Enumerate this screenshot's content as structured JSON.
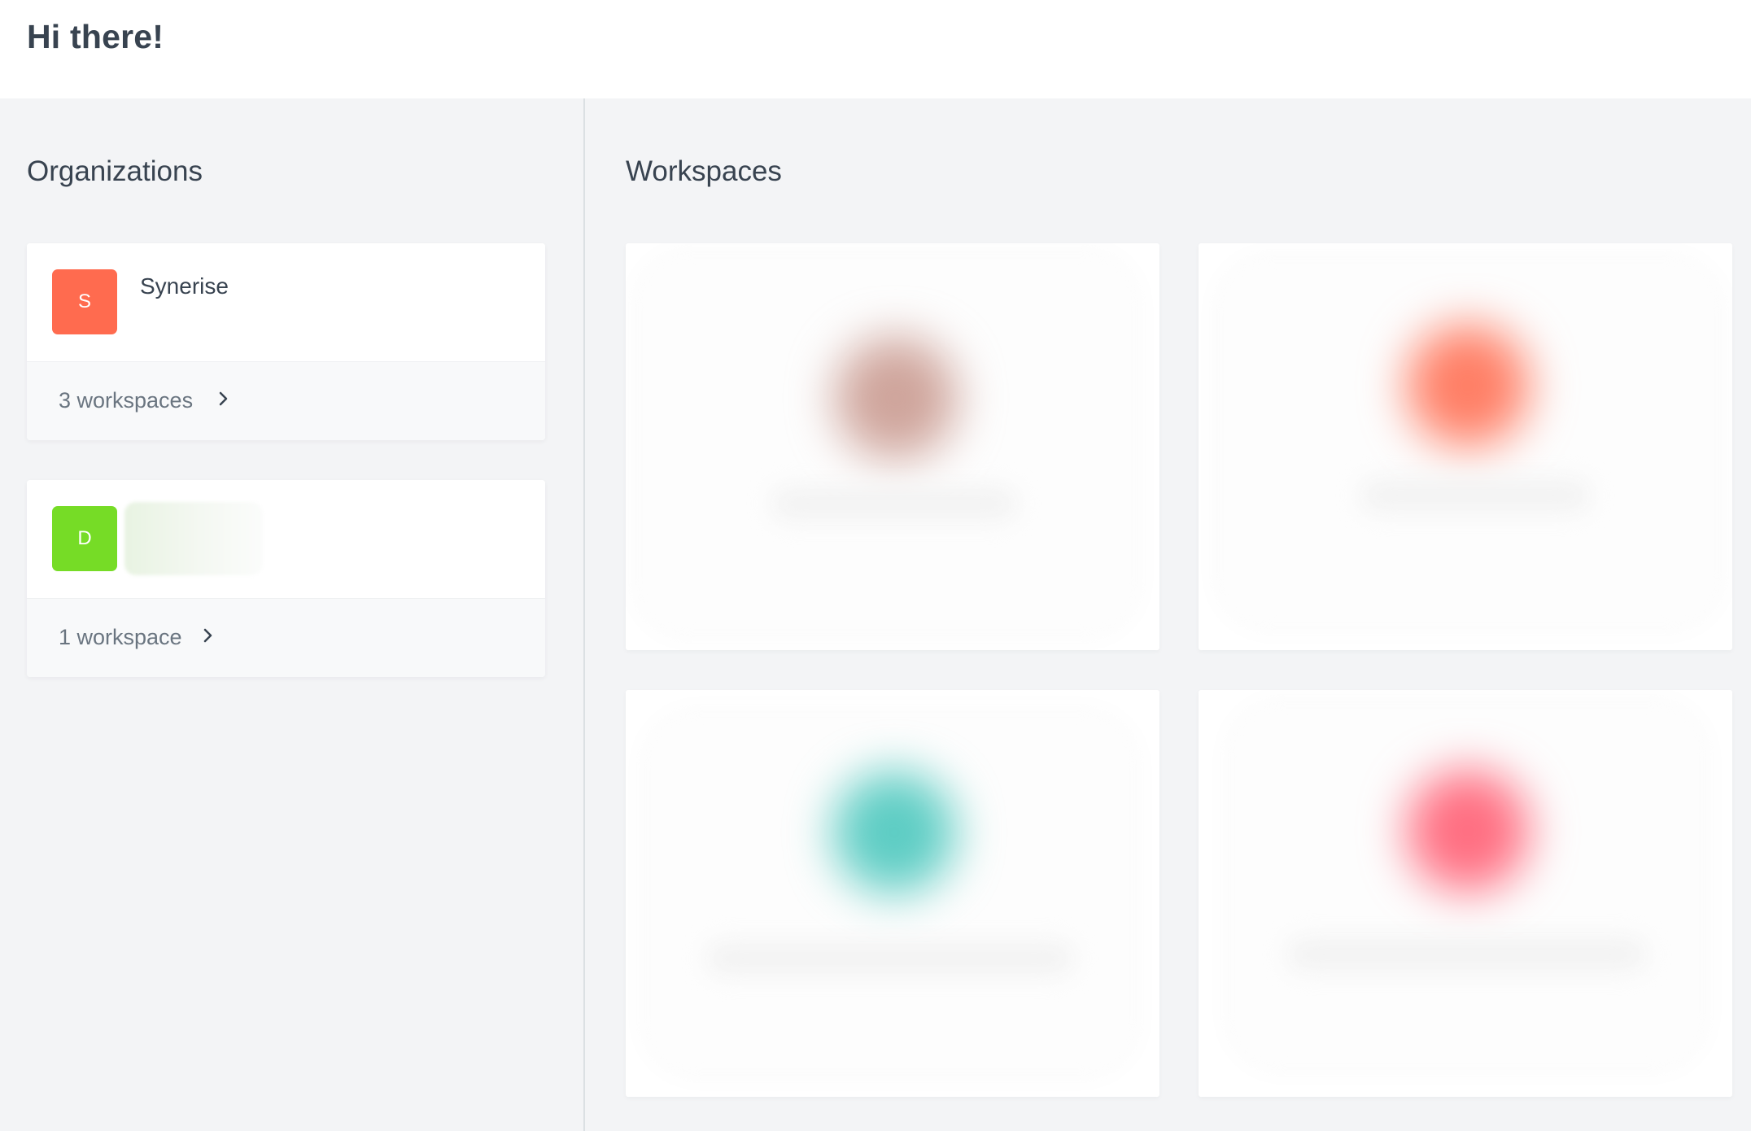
{
  "header": {
    "greeting": "Hi there!"
  },
  "organizations": {
    "title": "Organizations",
    "items": [
      {
        "initial": "S",
        "name": "Synerise",
        "count_label": "3 workspaces",
        "color": "#ff6b4f"
      },
      {
        "initial": "D",
        "name": "",
        "count_label": "1 workspace",
        "color": "#76dc26"
      }
    ]
  },
  "workspaces": {
    "title": "Workspaces",
    "items": [
      {
        "blob_color": "#cfa59c"
      },
      {
        "blob_color": "#ff7f66"
      },
      {
        "blob_color": "#5ecdc4"
      },
      {
        "blob_color": "#ff6f82"
      }
    ]
  },
  "icons": {
    "chevron": "chevron-right-icon"
  }
}
